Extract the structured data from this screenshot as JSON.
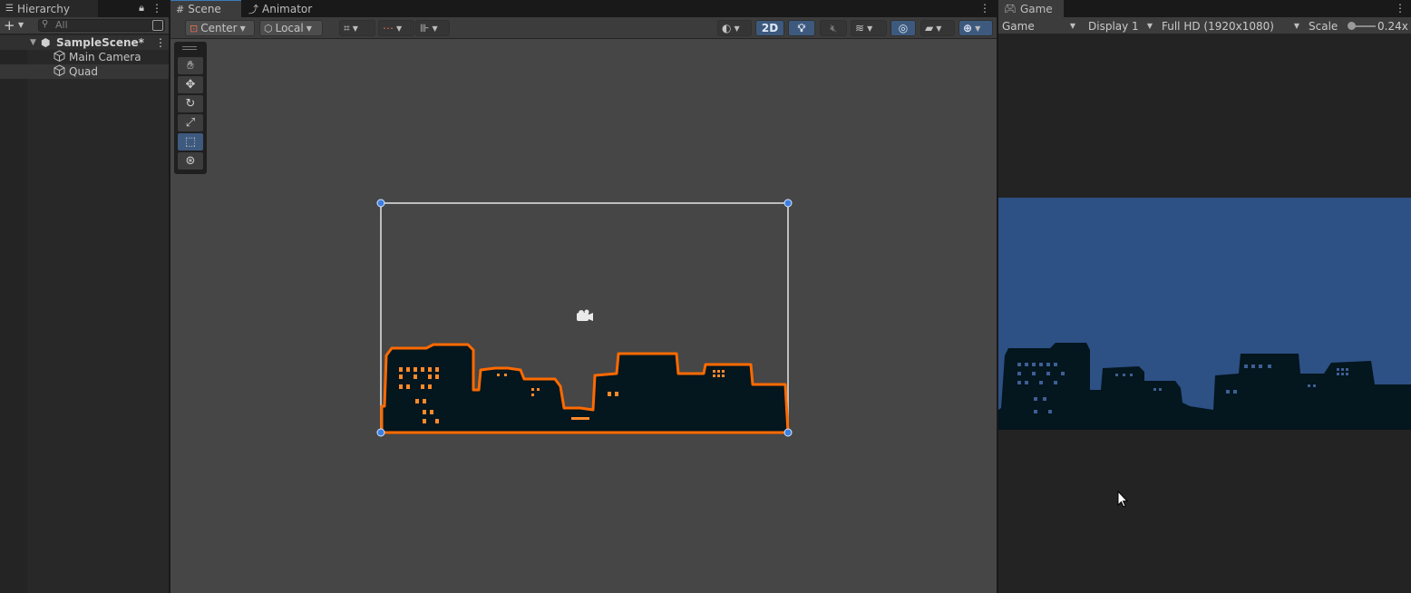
{
  "hierarchy": {
    "tab_label": "Hierarchy",
    "search_placeholder": "All",
    "scene_name": "SampleScene*",
    "items": [
      {
        "label": "Main Camera"
      },
      {
        "label": "Quad"
      }
    ]
  },
  "scene": {
    "tabs": [
      {
        "label": "Scene"
      },
      {
        "label": "Animator"
      }
    ],
    "toolbar": {
      "pivot_label": "Center",
      "space_label": "Local",
      "mode_2d_label": "2D"
    }
  },
  "game": {
    "tab_label": "Game",
    "view_select": "Game",
    "display_select": "Display 1",
    "resolution_select": "Full HD (1920x1080)",
    "scale_label": "Scale",
    "scale_value": "0.24x"
  },
  "colors": {
    "accent": "#3d5a7e",
    "selection_outline": "#ff6a00",
    "sky": "#2d5085",
    "building": "#04161e",
    "window_lit": "#ff8a2a",
    "window_dim": "#3d5f95"
  }
}
